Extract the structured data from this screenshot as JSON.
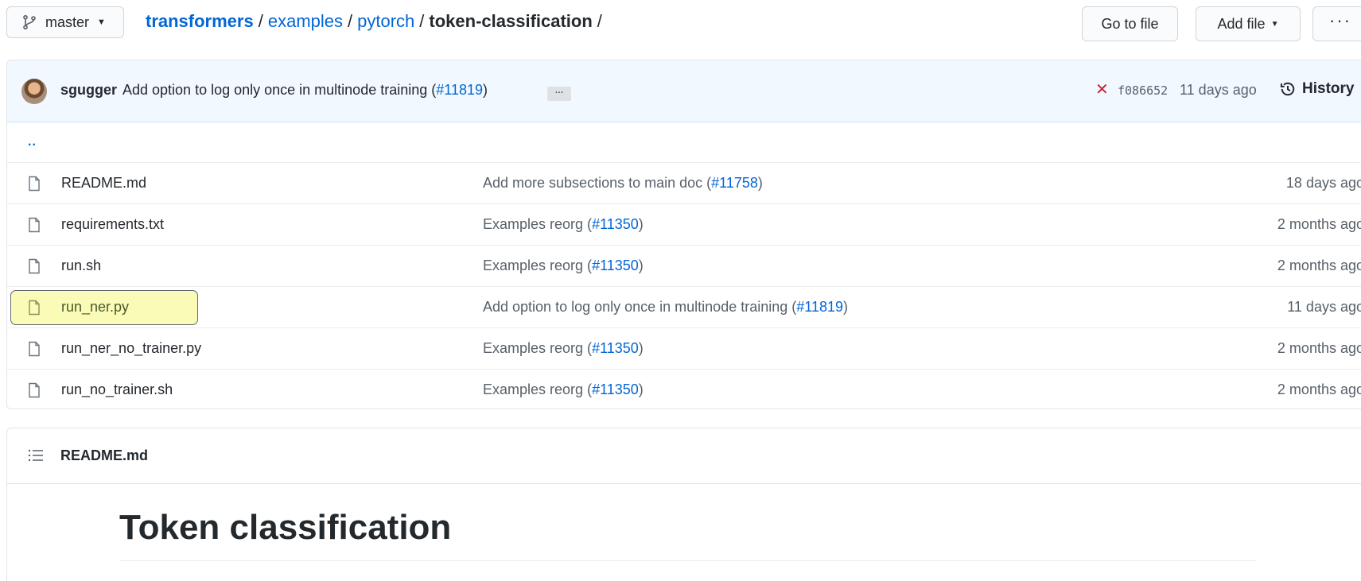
{
  "branch": {
    "name": "master"
  },
  "breadcrumb": {
    "repo": "transformers",
    "parts": [
      "examples",
      "pytorch"
    ],
    "current": "token-classification",
    "trailing": "/"
  },
  "toolbar": {
    "go_to_file": "Go to file",
    "add_file": "Add file",
    "more": "···"
  },
  "latest_commit": {
    "author": "sgugger",
    "message": "Add option to log only once in multinode training (",
    "pr": "#11819",
    "message_end": ")",
    "ellipsis": "…",
    "status": "✕",
    "sha": "f086652",
    "time": "11 days ago",
    "history": "History"
  },
  "parent_dir": "..",
  "files": [
    {
      "name": "README.md",
      "msg": "Add more subsections to main doc (",
      "pr": "#11758",
      "msg_end": ")",
      "time": "18 days ago"
    },
    {
      "name": "requirements.txt",
      "msg": "Examples reorg (",
      "pr": "#11350",
      "msg_end": ")",
      "time": "2 months ago"
    },
    {
      "name": "run.sh",
      "msg": "Examples reorg (",
      "pr": "#11350",
      "msg_end": ")",
      "time": "2 months ago"
    },
    {
      "name": "run_ner.py",
      "msg": "Add option to log only once in multinode training (",
      "pr": "#11819",
      "msg_end": ")",
      "time": "11 days ago"
    },
    {
      "name": "run_ner_no_trainer.py",
      "msg": "Examples reorg (",
      "pr": "#11350",
      "msg_end": ")",
      "time": "2 months ago"
    },
    {
      "name": "run_no_trainer.sh",
      "msg": "Examples reorg (",
      "pr": "#11350",
      "msg_end": ")",
      "time": "2 months ago"
    }
  ],
  "readme": {
    "filename": "README.md",
    "heading": "Token classification"
  },
  "colors": {
    "link": "#0366d6",
    "commit_bar_bg": "#f1f8ff",
    "failure": "#cb2431",
    "highlight": "#f9faa0"
  }
}
